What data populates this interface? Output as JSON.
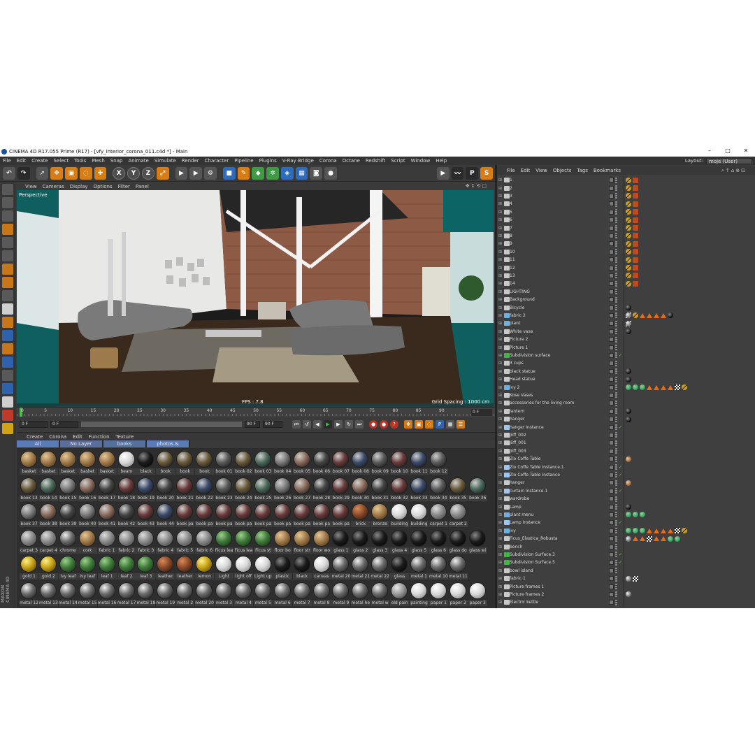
{
  "window": {
    "title": "CINEMA 4D R17.055 Prime (R17) - [vfy_interior_corona_011.c4d *] - Main",
    "controls": [
      "–",
      "□",
      "✕"
    ]
  },
  "menubar": [
    "File",
    "Edit",
    "Create",
    "Select",
    "Tools",
    "Mesh",
    "Snap",
    "Animate",
    "Simulate",
    "Render",
    "Character",
    "Pipeline",
    "Plugins",
    "V-Ray Bridge",
    "Corona",
    "Octane",
    "Redshift",
    "Script",
    "Window",
    "Help"
  ],
  "layout": {
    "label": "Layout:",
    "value": "moje (User)"
  },
  "toolbar": {
    "axis_x": "X",
    "axis_y": "Y",
    "axis_z": "Z"
  },
  "viewport": {
    "menu": [
      "View",
      "Cameras",
      "Display",
      "Options",
      "Filter",
      "Panel"
    ],
    "label": "Perspective",
    "fps": "FPS : 7.8",
    "grid_spacing": "Grid Spacing : 1000 cm"
  },
  "timeline": {
    "ticks": [
      "0",
      "5",
      "10",
      "15",
      "20",
      "25",
      "30",
      "35",
      "40",
      "45",
      "50",
      "55",
      "60",
      "65",
      "70",
      "75",
      "80",
      "85",
      "90"
    ],
    "current_frame": "0 F"
  },
  "transport": {
    "start_frame": "0 F",
    "preview_start": "0 F",
    "preview_end": "90 F",
    "end_frame": "90 F"
  },
  "material_manager": {
    "menu": [
      "Create",
      "Corona",
      "Edit",
      "Function",
      "Texture"
    ],
    "tabs": [
      "All",
      "No Layer",
      "books",
      "photos & paintings"
    ],
    "rows": [
      [
        "basket",
        "basket",
        "basket",
        "basket",
        "basket",
        "beam",
        "black",
        "book",
        "book",
        "book",
        "book 01",
        "book 02",
        "book 03",
        "book 04",
        "book 05",
        "book 06",
        "book 07",
        "book 08",
        "book 09",
        "book 10",
        "book 11",
        "book 12"
      ],
      [
        "book 13",
        "book 14",
        "book 15",
        "book 16",
        "book 17",
        "book 18",
        "book 19",
        "book 20",
        "book 21",
        "book 22",
        "book 23",
        "book 24",
        "book 25",
        "book 26",
        "book 27",
        "book 28",
        "book 29",
        "book 30",
        "book 31",
        "book 32",
        "book 33",
        "book 34",
        "book 35",
        "book 36"
      ],
      [
        "book 37",
        "book 38",
        "book 39",
        "book 40",
        "book 41",
        "book 42",
        "book 43",
        "book 44",
        "book pa",
        "book pa",
        "book pa",
        "book pa",
        "book pa",
        "book pa",
        "book pa",
        "book pa",
        "book pa",
        "brick",
        "bronze",
        "building",
        "building",
        "carpet 1",
        "carpet 2"
      ],
      [
        "carpet 3",
        "carpet 4",
        "chrome",
        "cork",
        "fabric 1",
        "fabric 2",
        "fabric 3",
        "fabric 4",
        "fabric 5",
        "fabric 6",
        "Ficus lea",
        "Ficus lea",
        "Ficus st",
        "floor bo",
        "floor str",
        "floor wo",
        "glass 1",
        "glass 2",
        "glass 3",
        "glass 4",
        "glass 5",
        "glass 6",
        "glass do",
        "glass wi"
      ],
      [
        "gold 1",
        "gold 2",
        "ivy leaf",
        "ivy leaf",
        "leaf 1",
        "leaf 2",
        "leaf 3",
        "leather",
        "leather",
        "lemon",
        "Light",
        "light off",
        "Light up",
        "plastic",
        "black",
        "canvas",
        "metal 20",
        "metal 21",
        "metal 22",
        "glass",
        "metal 1",
        "metal 10",
        "metal 11"
      ],
      [
        "metal 12",
        "metal 13",
        "metal 14",
        "metal 15",
        "metal 16",
        "metal 17",
        "metal 18",
        "metal 19",
        "metal 2",
        "metal 20",
        "metal 3",
        "metal 4",
        "metal 5",
        "metal 6",
        "metal 7",
        "metal 8",
        "metal 9",
        "metal he",
        "metal w",
        "old pain",
        "painting",
        "paper 1",
        "paper 2",
        "paper 3"
      ]
    ]
  },
  "object_manager": {
    "menu": [
      "File",
      "Edit",
      "View",
      "Objects",
      "Tags",
      "Bookmarks"
    ],
    "objects": [
      {
        "name": "1",
        "icon": "null",
        "tags": [
          "warn",
          "red"
        ],
        "tick": false
      },
      {
        "name": "2",
        "icon": "null",
        "tags": [
          "warn",
          "red"
        ],
        "tick": false
      },
      {
        "name": "3",
        "icon": "null",
        "tags": [
          "warn",
          "red"
        ],
        "tick": false
      },
      {
        "name": "4",
        "icon": "null",
        "tags": [
          "warn",
          "red"
        ],
        "tick": false
      },
      {
        "name": "5",
        "icon": "null",
        "tags": [
          "warn",
          "red"
        ],
        "tick": false
      },
      {
        "name": "6",
        "icon": "null",
        "tags": [
          "warn",
          "red"
        ],
        "tick": false
      },
      {
        "name": "7",
        "icon": "null",
        "tags": [
          "warn",
          "red"
        ],
        "tick": false
      },
      {
        "name": "8",
        "icon": "null",
        "tags": [
          "warn",
          "red"
        ],
        "tick": false
      },
      {
        "name": "9",
        "icon": "null",
        "tags": [
          "warn",
          "red"
        ],
        "tick": false
      },
      {
        "name": "10",
        "icon": "null",
        "tags": [
          "warn",
          "red"
        ],
        "tick": false
      },
      {
        "name": "11",
        "icon": "null",
        "tags": [
          "warn",
          "red"
        ],
        "tick": false
      },
      {
        "name": "12",
        "icon": "null",
        "tags": [
          "warn",
          "red"
        ],
        "tick": false
      },
      {
        "name": "13",
        "icon": "null",
        "tags": [
          "warn",
          "red"
        ],
        "tick": false
      },
      {
        "name": "14",
        "icon": "null",
        "tags": [
          "warn",
          "red"
        ],
        "tick": false
      },
      {
        "name": "LIGHTING",
        "icon": "null",
        "tags": [],
        "tick": false
      },
      {
        "name": "Background",
        "icon": "null",
        "tags": [],
        "tick": false
      },
      {
        "name": "Bicycle",
        "icon": "null",
        "tags": [
          "black"
        ],
        "tick": false
      },
      {
        "name": "fabric 2",
        "icon": "poly",
        "tags": [
          "mat",
          "checker",
          "warn",
          "tri",
          "tri",
          "tri",
          "tri",
          "black",
          "mat"
        ],
        "tick": false
      },
      {
        "name": "plant",
        "icon": "poly",
        "tags": [
          "checker",
          "mat"
        ],
        "tick": false
      },
      {
        "name": "White vase",
        "icon": "null",
        "tags": [
          "black"
        ],
        "tick": false
      },
      {
        "name": "Picture 2",
        "icon": "null",
        "tags": [],
        "tick": false
      },
      {
        "name": "Picture 1",
        "icon": "null",
        "tags": [],
        "tick": false
      },
      {
        "name": "Subdivision surface",
        "icon": "subd",
        "tags": [],
        "tick": true
      },
      {
        "name": "3 cups",
        "icon": "null",
        "tags": [],
        "tick": false
      },
      {
        "name": "black statue",
        "icon": "null",
        "tags": [
          "black"
        ],
        "tick": false
      },
      {
        "name": "Head statue",
        "icon": "null",
        "tags": [
          "black"
        ],
        "tick": false
      },
      {
        "name": "ivy 2",
        "icon": "poly",
        "tags": [
          "green",
          "green",
          "green",
          "tri",
          "tri",
          "tri",
          "tri",
          "checker",
          "warn"
        ],
        "tick": false
      },
      {
        "name": "Kose Vases",
        "icon": "null",
        "tags": [],
        "tick": false
      },
      {
        "name": "accessories for the living room",
        "icon": "null",
        "tags": [],
        "tick": false
      },
      {
        "name": "lantern",
        "icon": "null",
        "tags": [
          "black"
        ],
        "tick": false
      },
      {
        "name": "hanger",
        "icon": "null",
        "tags": [
          "black"
        ],
        "tick": false
      },
      {
        "name": "hanger Instance",
        "icon": "inst",
        "tags": [],
        "tick": true
      },
      {
        "name": "Jiiff_002",
        "icon": "null",
        "tags": [],
        "tick": false
      },
      {
        "name": "Jiiff_001",
        "icon": "null",
        "tags": [],
        "tick": false
      },
      {
        "name": "Jiiff_003",
        "icon": "null",
        "tags": [],
        "tick": false
      },
      {
        "name": "Zio Coffe Table",
        "icon": "null",
        "tags": [
          "brown"
        ],
        "tick": false
      },
      {
        "name": "Zio Coffe Table Instance.1",
        "icon": "inst",
        "tags": [],
        "tick": true
      },
      {
        "name": "Zio Coffe Table Instance",
        "icon": "inst",
        "tags": [],
        "tick": true
      },
      {
        "name": "hanger",
        "icon": "null",
        "tags": [
          "brown"
        ],
        "tick": false
      },
      {
        "name": "curtain Instance.1",
        "icon": "inst",
        "tags": [],
        "tick": true
      },
      {
        "name": "wardrobe",
        "icon": "null",
        "tags": [],
        "tick": false
      },
      {
        "name": "Lamp",
        "icon": "null",
        "tags": [
          "black"
        ],
        "tick": false
      },
      {
        "name": "plant menu",
        "icon": "poly",
        "tags": [
          "green",
          "green",
          "green"
        ],
        "tick": false
      },
      {
        "name": "Lamp Instance",
        "icon": "inst",
        "tags": [],
        "tick": true
      },
      {
        "name": "ivy",
        "icon": "poly",
        "tags": [
          "green",
          "green",
          "green",
          "tri",
          "tri",
          "tri",
          "tri",
          "checker",
          "warn"
        ],
        "tick": false
      },
      {
        "name": "Ficus_Elastica_Robusta",
        "icon": "null",
        "tags": [
          "green",
          "tri",
          "tri",
          "checker",
          "tri",
          "tri",
          "mat",
          "green",
          "green"
        ],
        "tick": false
      },
      {
        "name": "bench",
        "icon": "null",
        "tags": [],
        "tick": false
      },
      {
        "name": "Subdivision Surface.3",
        "icon": "subd",
        "tags": [],
        "tick": true
      },
      {
        "name": "Subdivision Surface.5",
        "icon": "subd",
        "tags": [],
        "tick": true
      },
      {
        "name": "bowl island",
        "icon": "null",
        "tags": [],
        "tick": false
      },
      {
        "name": "fabric 1",
        "icon": "null",
        "tags": [
          "warn",
          "checker",
          "mat"
        ],
        "tick": false
      },
      {
        "name": "Picture frames 1",
        "icon": "null",
        "tags": [],
        "tick": false
      },
      {
        "name": "Picture frames 2",
        "icon": "null",
        "tags": [
          "mat",
          "mat"
        ],
        "tick": false
      },
      {
        "name": "Electric kettle",
        "icon": "null",
        "tags": [],
        "tick": false
      }
    ]
  },
  "colors": {
    "ui_bg": "#3c3c3c",
    "viewport_bg": "#0d5a5a",
    "accent_orange": "#d77d16",
    "accent_blue": "#2f6bbd",
    "check_green": "#5cd55c"
  }
}
